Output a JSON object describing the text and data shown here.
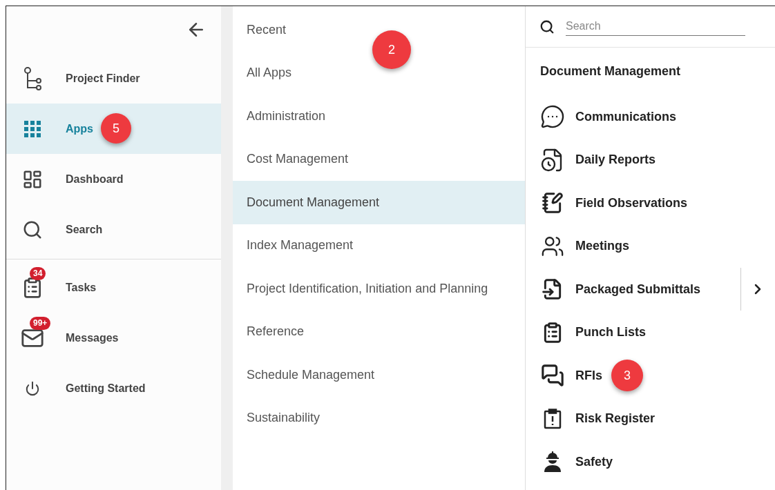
{
  "nav": {
    "items": [
      {
        "label": "Project Finder",
        "selected": false
      },
      {
        "label": "Apps",
        "selected": true,
        "callout": "5"
      },
      {
        "label": "Dashboard",
        "selected": false
      },
      {
        "label": "Search",
        "selected": false
      }
    ],
    "secondary_items": [
      {
        "label": "Tasks",
        "badge": "34"
      },
      {
        "label": "Messages",
        "badge": "99+"
      },
      {
        "label": "Getting Started"
      }
    ]
  },
  "categories": {
    "callout": "2",
    "items": [
      {
        "label": "Recent",
        "selected": false
      },
      {
        "label": "All Apps",
        "selected": false
      },
      {
        "label": "Administration",
        "selected": false
      },
      {
        "label": "Cost Management",
        "selected": false
      },
      {
        "label": "Document Management",
        "selected": true
      },
      {
        "label": "Index Management",
        "selected": false
      },
      {
        "label": "Project Identification, Initiation and Planning",
        "selected": false
      },
      {
        "label": "Reference",
        "selected": false
      },
      {
        "label": "Schedule Management",
        "selected": false
      },
      {
        "label": "Sustainability",
        "selected": false
      }
    ]
  },
  "apps": {
    "search": {
      "placeholder": "Search"
    },
    "heading": "Document Management",
    "items": [
      {
        "label": "Communications"
      },
      {
        "label": "Daily Reports"
      },
      {
        "label": "Field Observations"
      },
      {
        "label": "Meetings"
      },
      {
        "label": "Packaged Submittals",
        "has_submenu": true
      },
      {
        "label": "Punch Lists"
      },
      {
        "label": "RFIs",
        "callout": "3"
      },
      {
        "label": "Risk Register"
      },
      {
        "label": "Safety"
      }
    ]
  }
}
